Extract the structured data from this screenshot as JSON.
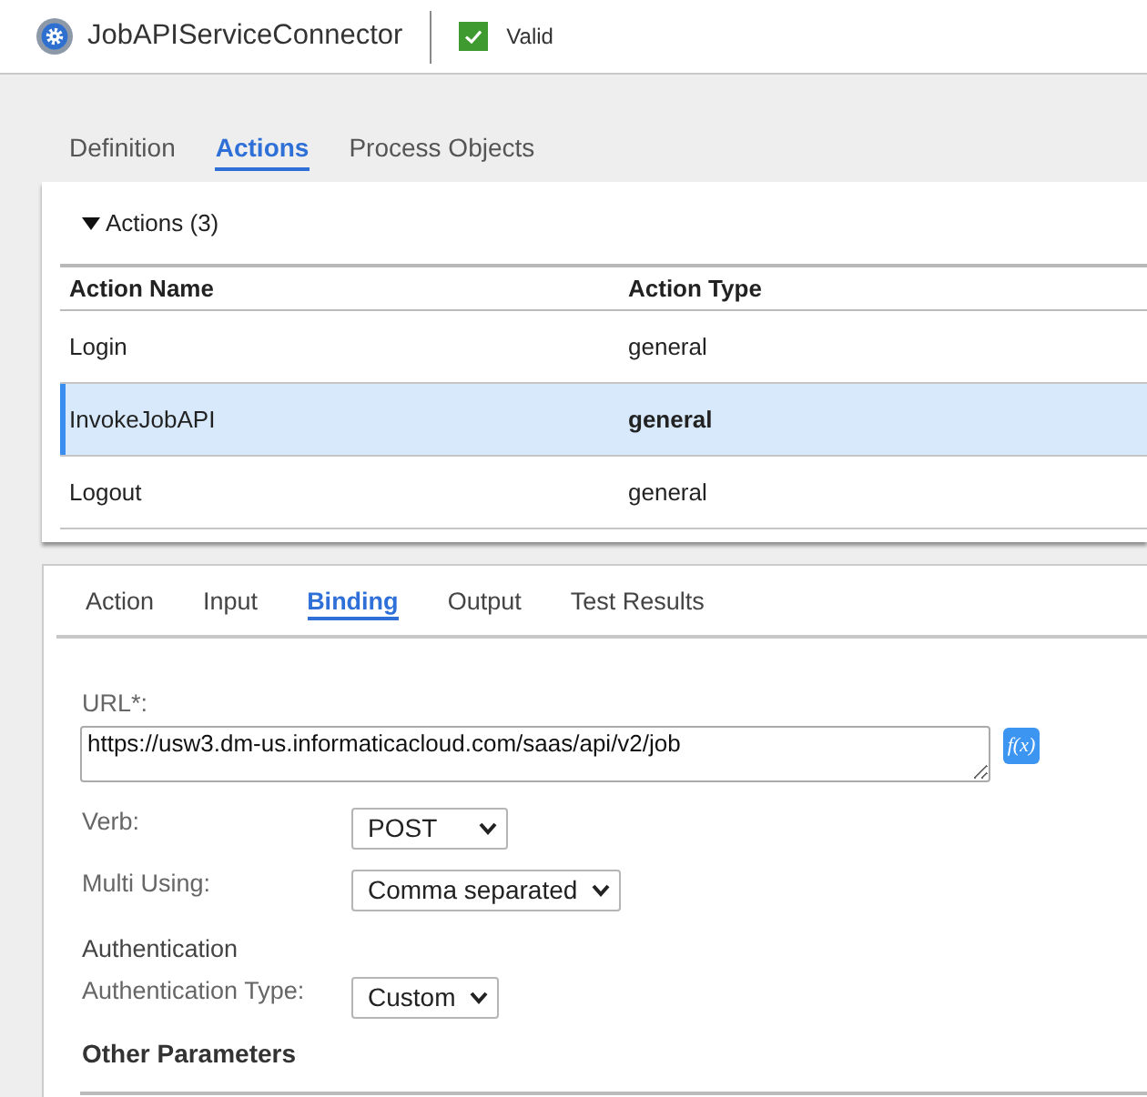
{
  "header": {
    "title": "JobAPIServiceConnector",
    "status": {
      "label": "Valid",
      "valid": true
    }
  },
  "tabs": [
    {
      "label": "Definition",
      "selected": false
    },
    {
      "label": "Actions",
      "selected": true
    },
    {
      "label": "Process Objects",
      "selected": false
    }
  ],
  "actions": {
    "heading": "Actions (3)",
    "expanded": true,
    "columns": [
      "Action Name",
      "Action Type"
    ],
    "rows": [
      {
        "name": "Login",
        "type": "general",
        "selected": false
      },
      {
        "name": "InvokeJobAPI",
        "type": "general",
        "selected": true
      },
      {
        "name": "Logout",
        "type": "general",
        "selected": false
      }
    ]
  },
  "action_tabs": [
    {
      "label": "Action",
      "selected": false
    },
    {
      "label": "Input",
      "selected": false
    },
    {
      "label": "Binding",
      "selected": true
    },
    {
      "label": "Output",
      "selected": false
    },
    {
      "label": "Test Results",
      "selected": false
    }
  ],
  "binding": {
    "fields": [
      {
        "kind": "textarea",
        "label": "URL*:",
        "value": "https://usw3.dm-us.informaticacloud.com/saas/api/v2/job",
        "button": "f(x)"
      },
      {
        "kind": "select",
        "label": "Verb:",
        "value": "POST"
      },
      {
        "kind": "select",
        "label": "Multi Using:",
        "value": "Comma separated"
      },
      {
        "kind": "heading",
        "label": "Authentication"
      },
      {
        "kind": "select",
        "label": "Authentication Type:",
        "value": "Custom"
      },
      {
        "kind": "section",
        "label": "Other Parameters"
      }
    ]
  }
}
